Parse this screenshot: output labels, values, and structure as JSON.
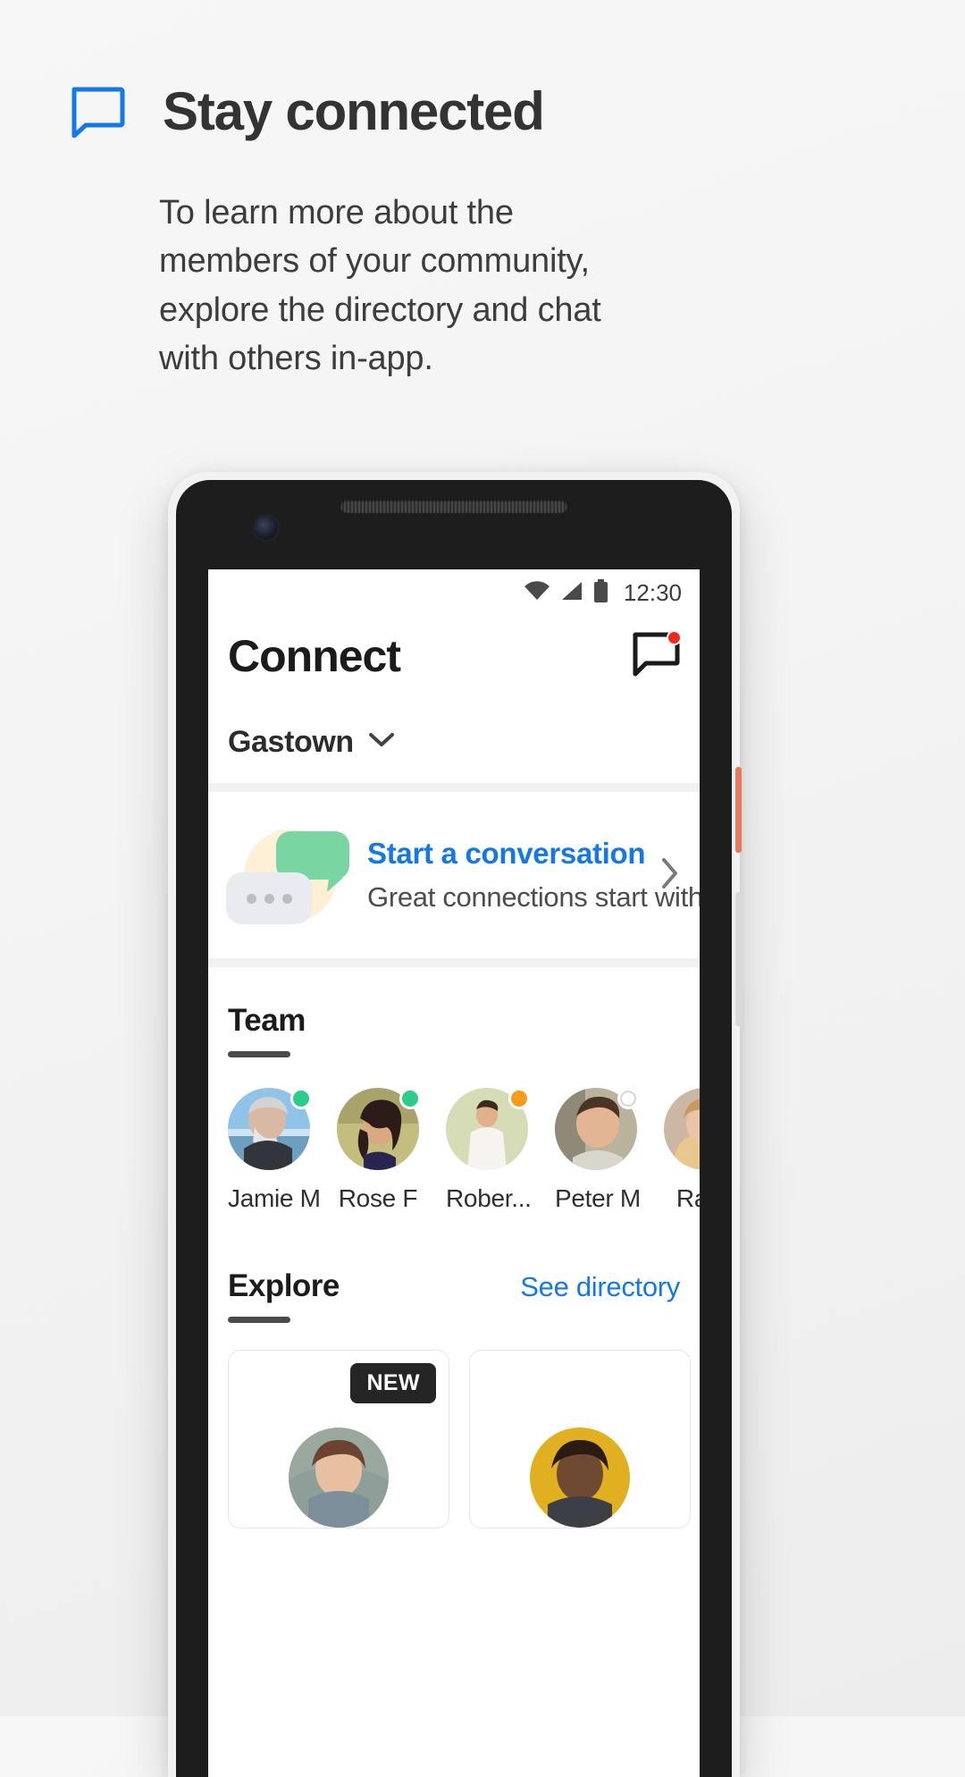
{
  "promo": {
    "icon": "chat-bubble-icon",
    "title": "Stay connected",
    "body": "To learn more about the members of your community, explore the directory and chat with others in-app.",
    "accent_color": "#1478e8"
  },
  "phone": {
    "status_bar": {
      "wifi_icon": "wifi-icon",
      "signal_icon": "cell-signal-icon",
      "battery_icon": "battery-icon",
      "time": "12:30"
    },
    "app_header": {
      "title": "Connect",
      "messages_icon": "message-bubble-icon",
      "has_unread_badge": true,
      "badge_color": "#f3291f"
    },
    "community_selector": {
      "name": "Gastown",
      "chevron_icon": "chevron-down-icon"
    },
    "conversation_card": {
      "illustration": "chat-bubbles-illustration",
      "title": "Start a conversation",
      "subtitle": "Great connections start with 👋",
      "chevron_icon": "chevron-right-icon",
      "title_color": "#1478e8"
    },
    "team_section": {
      "title": "Team",
      "members": [
        {
          "name": "Jamie M",
          "presence": "online",
          "presence_color": "#2ecc8b"
        },
        {
          "name": "Rose F",
          "presence": "online",
          "presence_color": "#2ecc8b"
        },
        {
          "name": "Rober...",
          "presence": "away",
          "presence_color": "#f89b1c"
        },
        {
          "name": "Peter M",
          "presence": "offline",
          "presence_color": "#ffffff"
        },
        {
          "name": "Rach",
          "presence": "online",
          "presence_color": "#2ecc8b"
        }
      ]
    },
    "explore_section": {
      "title": "Explore",
      "link": "See directory",
      "link_color": "#1478e8",
      "cards": [
        {
          "badge": "NEW"
        },
        {
          "badge": ""
        },
        {
          "badge": ""
        }
      ]
    }
  }
}
